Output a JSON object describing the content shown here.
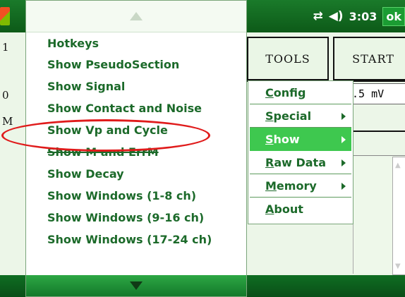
{
  "status_bar": {
    "connection_icon": "sync-arrows-icon",
    "volume_icon": "speaker-icon",
    "time": "3:03",
    "ok_label": "ok"
  },
  "toolbar": {
    "tools_label": "TOOLS",
    "start_label": "START"
  },
  "readout": {
    "value": ".5 mV"
  },
  "left_fragments": [
    "1",
    "0",
    "M"
  ],
  "submenu": {
    "items": [
      "Hotkeys",
      "Show PseudoSection",
      "Show Signal",
      "Show Contact and Noise",
      "Show Vp and Cycle",
      "Show M and ErrM",
      "Show Decay",
      "Show Windows (1-8 ch)",
      "Show Windows (9-16 ch)",
      "Show Windows (17-24 ch)"
    ]
  },
  "mainmenu": {
    "items": [
      {
        "label": "Config",
        "has_submenu": false
      },
      {
        "label": "Special",
        "has_submenu": true
      },
      {
        "label": "Show",
        "has_submenu": true,
        "selected": true
      },
      {
        "label": "Raw Data",
        "has_submenu": true
      },
      {
        "label": "Memory",
        "has_submenu": true
      },
      {
        "label": "About",
        "has_submenu": false
      }
    ]
  },
  "colors": {
    "menu_text": "#1c6a2a",
    "selection": "#3ec84f",
    "annotation": "#e01b1b"
  }
}
